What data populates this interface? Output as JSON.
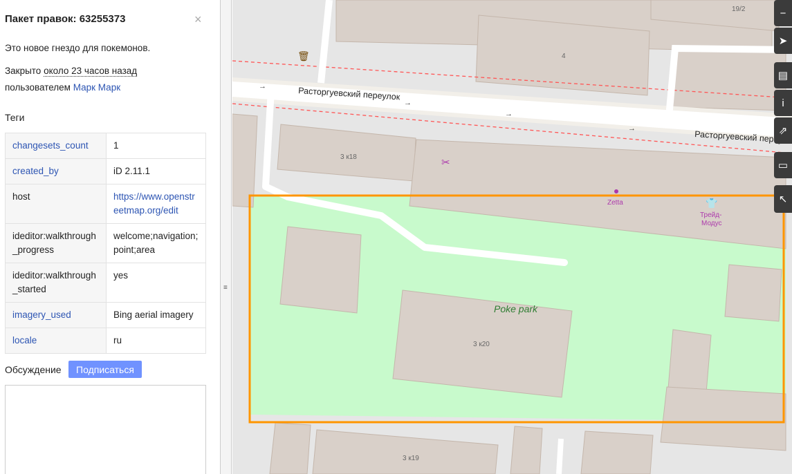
{
  "changeset": {
    "title": "Пакет правок: 63255373",
    "close_glyph": "×",
    "comment": "Это новое гнездо для покемонов.",
    "closed_prefix": "Закрыто ",
    "closed_time": "около 23 часов назад",
    "by_prefix": "пользователем ",
    "user": "Марк Марк"
  },
  "tags": {
    "heading": "Теги",
    "rows": [
      {
        "key": "changesets_count",
        "value": "1"
      },
      {
        "key": "created_by",
        "value": "iD 2.11.1"
      },
      {
        "key": "host",
        "value": "https://www.openstreetmap.org/edit"
      },
      {
        "key": "ideditor:walkthrough_progress",
        "value": "welcome;navigation;point;area"
      },
      {
        "key": "ideditor:walkthrough_started",
        "value": "yes"
      },
      {
        "key": "imagery_used",
        "value": "Bing aerial imagery"
      },
      {
        "key": "locale",
        "value": "ru"
      }
    ]
  },
  "discussion": {
    "label": "Обсуждение",
    "subscribe_label": "Подписаться",
    "input_value": ""
  },
  "map": {
    "street_name": "Расторгуевский переулок",
    "street_name_right": "Расторгуевский переул",
    "park_name": "Poke park",
    "building_labels": [
      "19/2",
      "4",
      "3 к18",
      "3 к20",
      "3 к19"
    ],
    "poi_zetta": "Zetta",
    "poi_trade": [
      "Трейд-",
      "Модус"
    ],
    "colors": {
      "park": "#c8facc",
      "building": "#d9d0c9",
      "building_stroke": "#c4b6ab",
      "road": "#ffffff",
      "highlight": "#ff9500",
      "label_park": "#2e7d32",
      "poi": "#ac39ac"
    }
  },
  "controls": {
    "icons": [
      "zoom-out-icon",
      "geolocate-icon",
      "layers-icon",
      "info-icon",
      "share-icon",
      "notes-icon",
      "query-icon"
    ]
  }
}
